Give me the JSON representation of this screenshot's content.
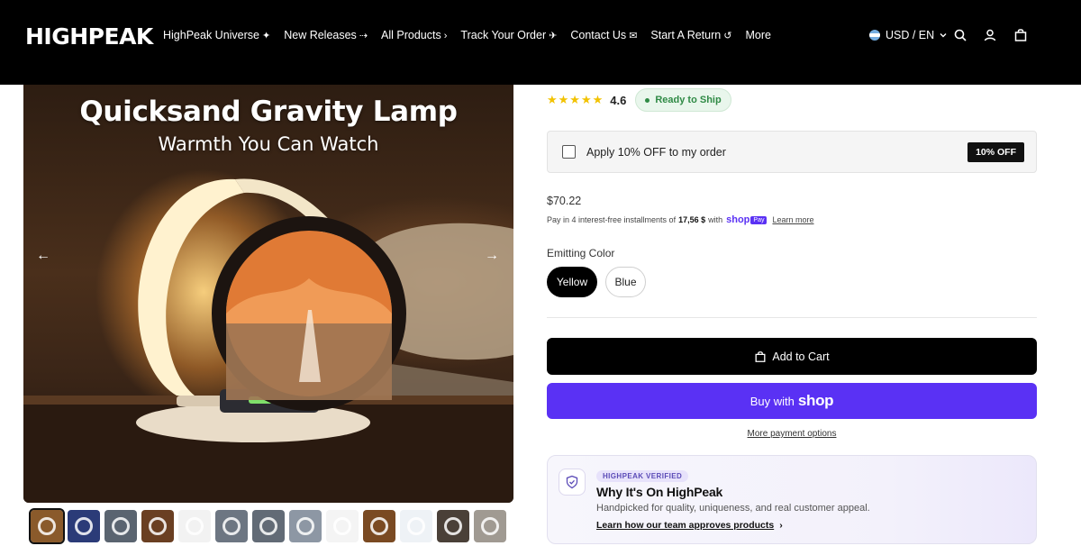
{
  "header": {
    "logo": "HIGHPEAK",
    "nav": [
      {
        "label": "HighPeak Universe",
        "glyph": "✦"
      },
      {
        "label": "New Releases",
        "glyph": "⇢"
      },
      {
        "label": "All Products",
        "glyph": "›"
      },
      {
        "label": "Track Your Order",
        "glyph": "✈"
      },
      {
        "label": "Contact Us",
        "glyph": "✉"
      },
      {
        "label": "Start A Return",
        "glyph": "↺"
      },
      {
        "label": "More",
        "glyph": ""
      }
    ],
    "locale": "USD / EN",
    "icons": [
      "search-icon",
      "account-icon",
      "cart-icon"
    ]
  },
  "gallery": {
    "title": "Quicksand Gravity Lamp",
    "subtitle": "Warmth You Can Watch",
    "prev": "←",
    "next": "→",
    "thumbnails": [
      {
        "active": true,
        "bg": "#8a5a2b"
      },
      {
        "active": false,
        "bg": "#2b3b78"
      },
      {
        "active": false,
        "bg": "#5a6470"
      },
      {
        "active": false,
        "bg": "#6a3f22"
      },
      {
        "active": false,
        "bg": "#f2f2f2"
      },
      {
        "active": false,
        "bg": "#6d7682"
      },
      {
        "active": false,
        "bg": "#626b76"
      },
      {
        "active": false,
        "bg": "#8d97a4"
      },
      {
        "active": false,
        "bg": "#f4f4f4"
      },
      {
        "active": false,
        "bg": "#7a4a22"
      },
      {
        "active": false,
        "bg": "#eef2f6"
      },
      {
        "active": false,
        "bg": "#4a4038"
      },
      {
        "active": false,
        "bg": "#a09a92"
      }
    ]
  },
  "product": {
    "stars": "★★★★★",
    "rating": "4.6",
    "ready": "Ready to Ship",
    "discount_label": "Apply 10% OFF to my order",
    "discount_badge": "10% OFF",
    "price": "$70.22",
    "installments_pre": "Pay in 4 interest-free installments of",
    "installments_amount": "17,56 $",
    "installments_with": "with",
    "shop_logo": "shop",
    "pay_tag": "Pay",
    "learn_more": "Learn more",
    "color_label": "Emitting Color",
    "colors": [
      "Yellow",
      "Blue"
    ],
    "add_to_cart": "Add to Cart",
    "buy_with": "Buy with",
    "buy_shop": "shop",
    "more_payment": "More payment options"
  },
  "verified": {
    "badge": "HIGHPEAK VERIFIED",
    "title": "Why It's On HighPeak",
    "desc": "Handpicked for quality, uniqueness, and real customer appeal.",
    "link": "Learn how our team approves products"
  },
  "colors": {
    "accent": "#5a31f4",
    "star": "#f2c200",
    "ready": "#2f8a45"
  }
}
